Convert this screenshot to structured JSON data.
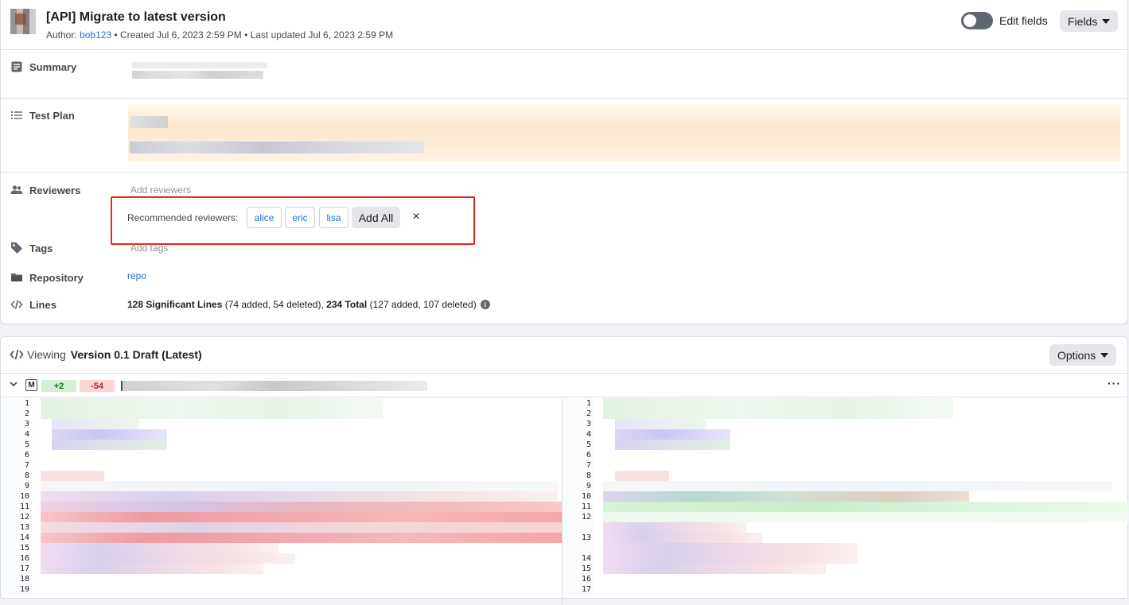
{
  "header": {
    "title": "[API] Migrate to latest version",
    "author_label": "Author:",
    "author": "bob123",
    "created": "• Created Jul 6, 2023 2:59 PM",
    "updated": "• Last updated Jul 6, 2023 2:59 PM",
    "edit_fields_label": "Edit fields",
    "fields_button": "Fields"
  },
  "fields": {
    "summary_label": "Summary",
    "test_plan_label": "Test Plan",
    "reviewers_label": "Reviewers",
    "reviewers_placeholder": "Add reviewers",
    "tags_label": "Tags",
    "tags_placeholder": "Add tags",
    "repository_label": "Repository",
    "repository_value": "repo",
    "lines_label": "Lines",
    "lines": {
      "significant": "128 Significant Lines",
      "significant_detail": " (74 added, 54 deleted), ",
      "total": "234 Total",
      "total_detail": " (127 added, 107 deleted)"
    }
  },
  "recommended": {
    "label": "Recommended reviewers:",
    "reviewers": [
      "alice",
      "eric",
      "lisa"
    ],
    "add_all": "Add All",
    "dismiss": "×"
  },
  "diff": {
    "viewing_label": "Viewing",
    "version": "Version 0.1 Draft (Latest)",
    "options_button": "Options",
    "file_badge": "M",
    "added": "+2",
    "deleted": "-54",
    "more": "···",
    "left_lines": [
      "1",
      "2",
      "3",
      "4",
      "5",
      "6",
      "7",
      "8",
      "9",
      "10",
      "11",
      "12",
      "13",
      "14",
      "15",
      "16",
      "17",
      "18",
      "19"
    ],
    "right_lines": [
      "1",
      "2",
      "3",
      "4",
      "5",
      "6",
      "7",
      "8",
      "9",
      "10",
      "11",
      "12",
      "",
      "13",
      "",
      "14",
      "15",
      "16",
      "17"
    ]
  }
}
